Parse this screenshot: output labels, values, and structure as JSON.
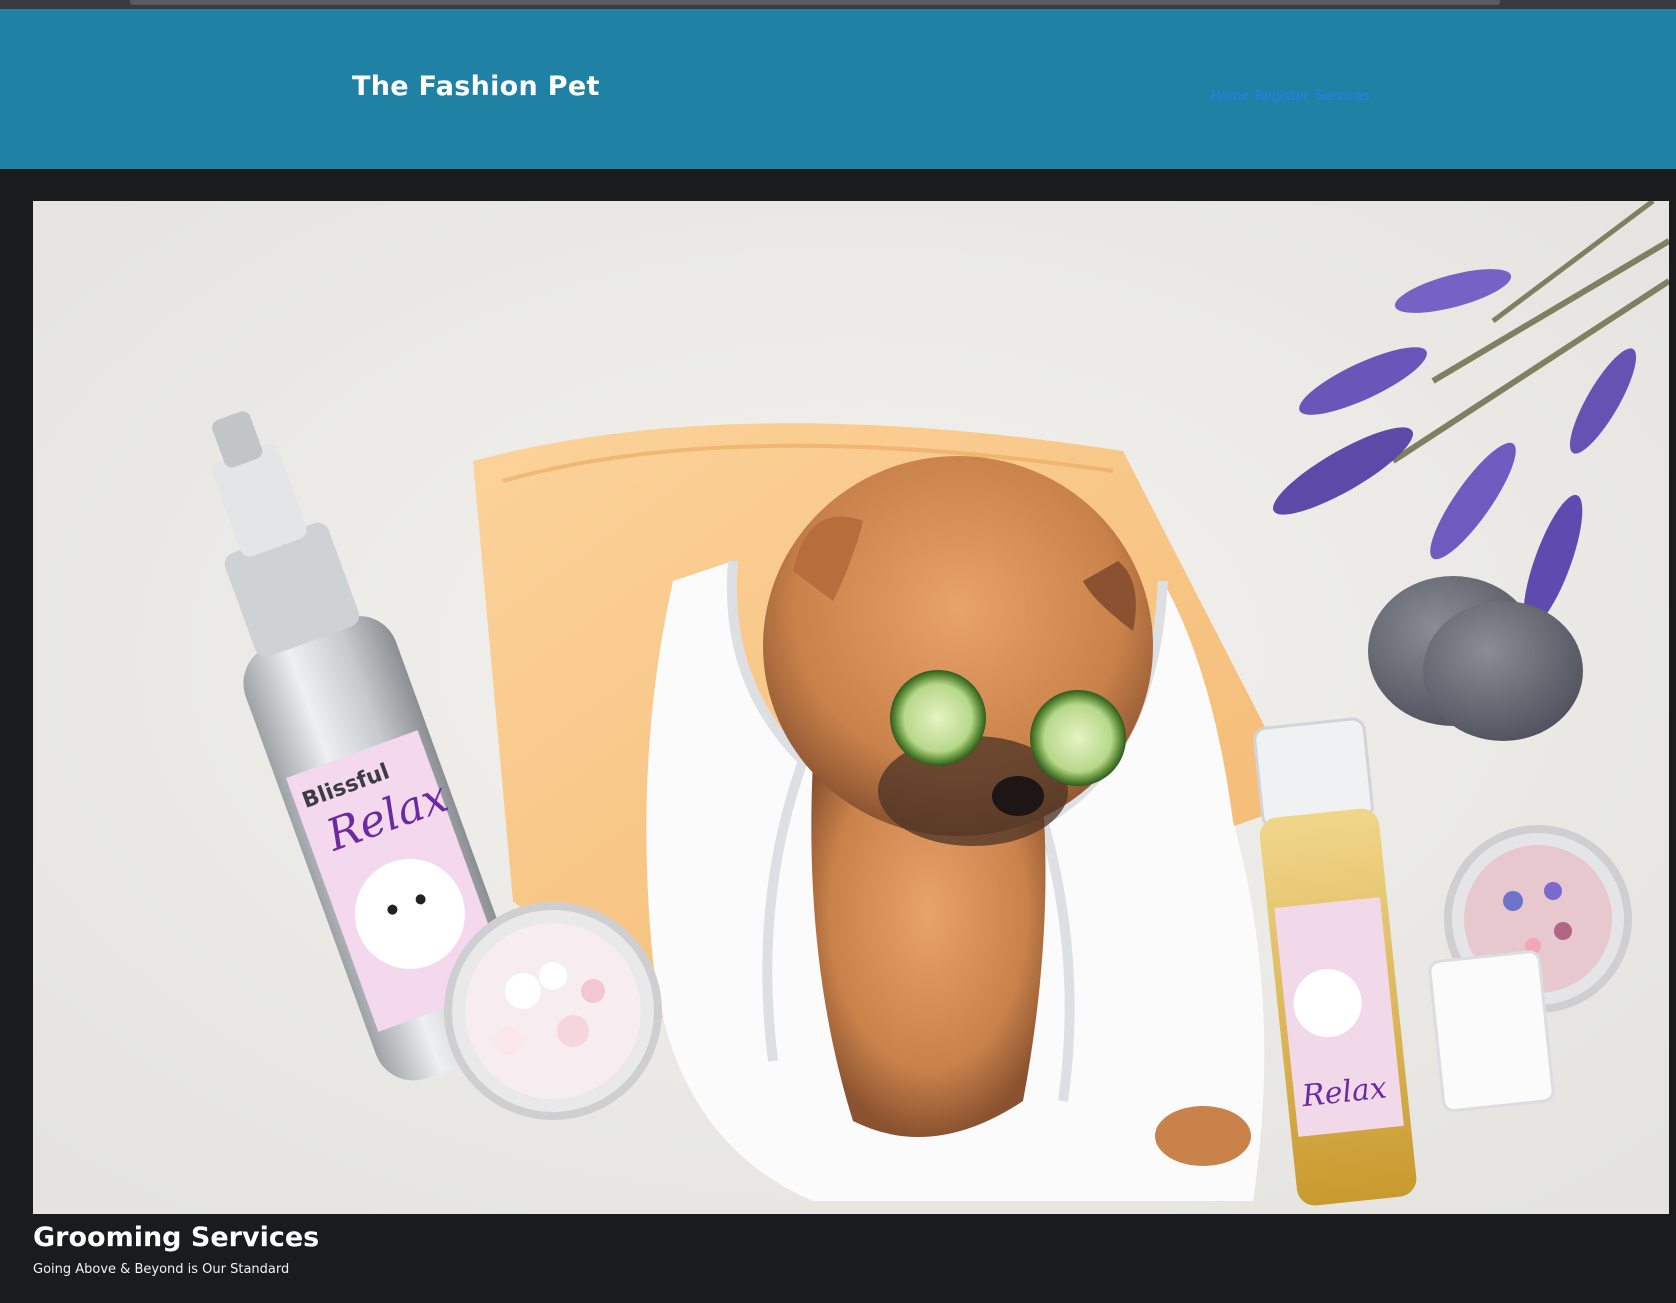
{
  "header": {
    "brand": "The Fashion Pet",
    "nav": [
      {
        "label": "Home"
      },
      {
        "label": "Register"
      },
      {
        "label": "Services"
      }
    ]
  },
  "hero": {
    "image": "pomeranian-spa-photo",
    "product_label_brand": "Blissful",
    "product_label_suffix": "dog",
    "product_label_name": "Relax"
  },
  "section": {
    "title": "Grooming Services",
    "subtitle": "Going Above & Beyond is Our Standard"
  },
  "colors": {
    "header_bg": "#1f81a4",
    "page_bg": "#1a1b1d",
    "nav_link": "#2f7cf2",
    "brand_text": "#ffffff"
  }
}
